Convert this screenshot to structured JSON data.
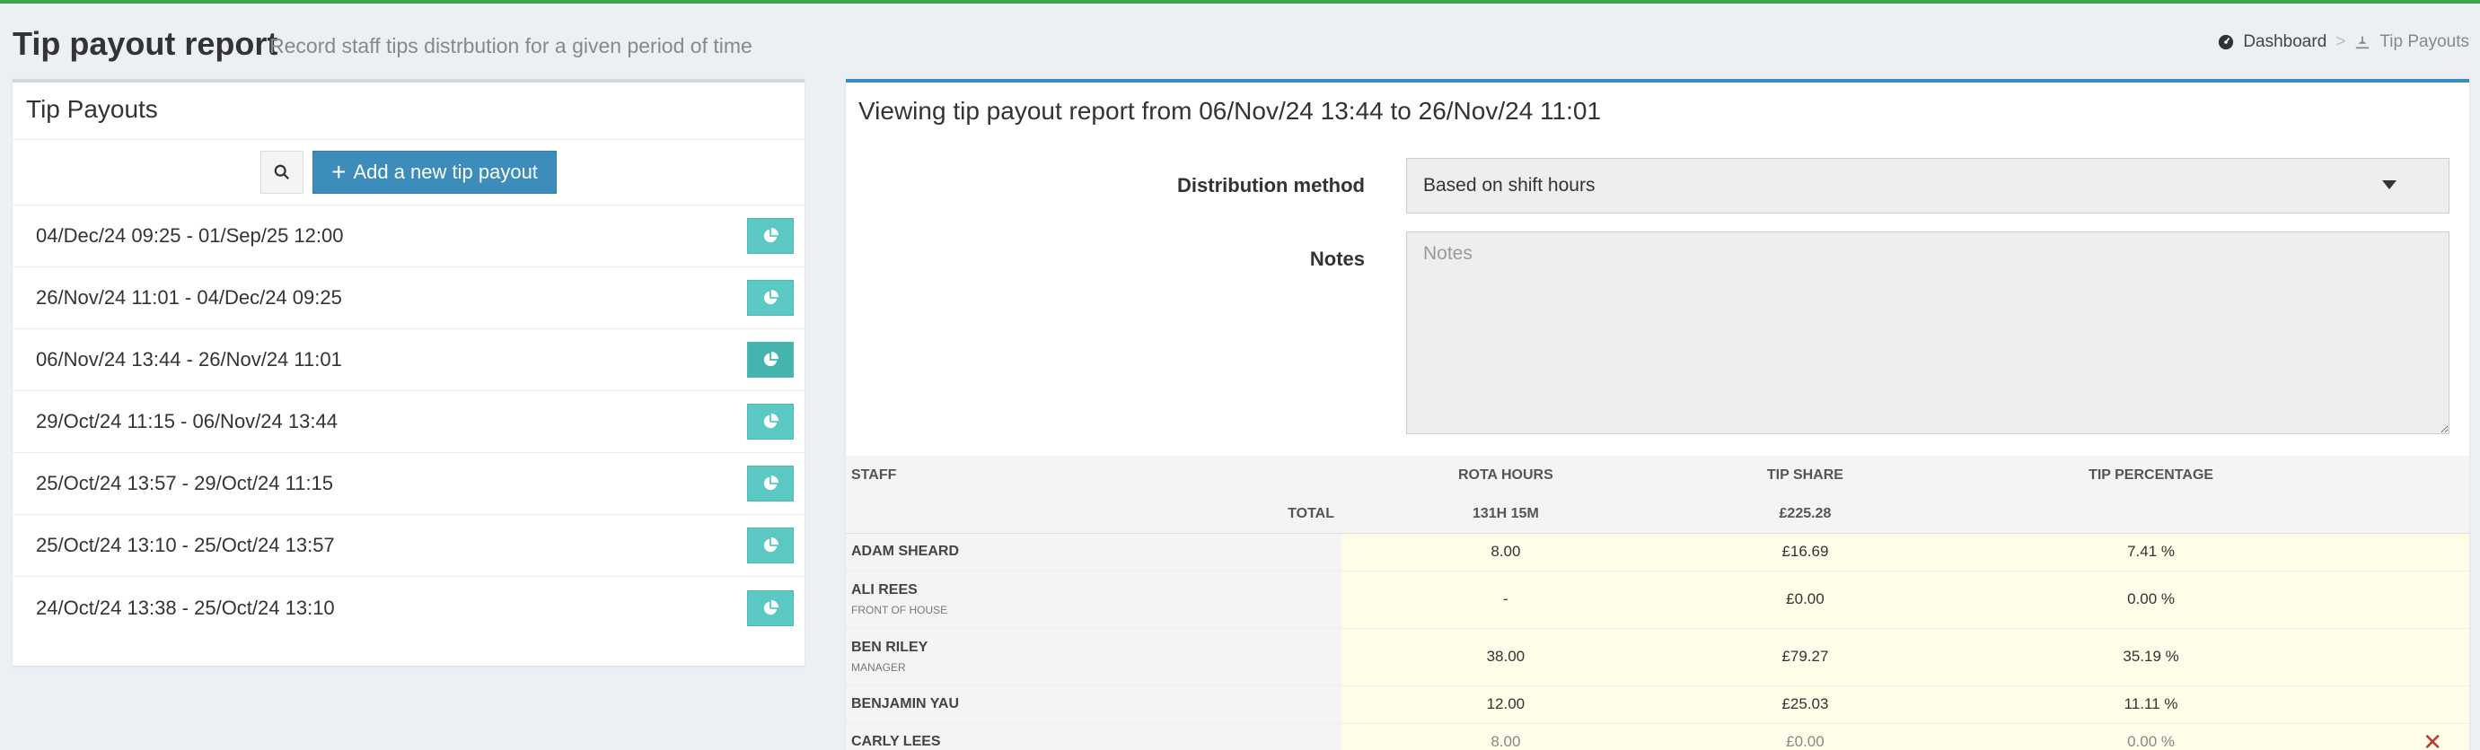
{
  "header": {
    "title": "Tip payout report",
    "subtitle": "Record staff tips distrbution for a given period of time"
  },
  "breadcrumb": {
    "dashboard": "Dashboard",
    "separator": ">",
    "current": "Tip Payouts"
  },
  "left_panel": {
    "title": "Tip Payouts",
    "add_button": "Add a new tip payout",
    "items": [
      {
        "label": "04/Dec/24 09:25 - 01/Sep/25 12:00",
        "active": false
      },
      {
        "label": "26/Nov/24 11:01 - 04/Dec/24 09:25",
        "active": false
      },
      {
        "label": "06/Nov/24 13:44 - 26/Nov/24 11:01",
        "active": true
      },
      {
        "label": "29/Oct/24 11:15 - 06/Nov/24 13:44",
        "active": false
      },
      {
        "label": "25/Oct/24 13:57 - 29/Oct/24 11:15",
        "active": false
      },
      {
        "label": "25/Oct/24 13:10 - 25/Oct/24 13:57",
        "active": false
      },
      {
        "label": "24/Oct/24 13:38 - 25/Oct/24 13:10",
        "active": false
      }
    ]
  },
  "report": {
    "title": "Viewing tip payout report from 06/Nov/24 13:44 to 26/Nov/24 11:01",
    "distribution_label": "Distribution method",
    "distribution_value": "Based on shift hours",
    "notes_label": "Notes",
    "notes_placeholder": "Notes",
    "notes_value": ""
  },
  "table": {
    "headers": {
      "staff": "Staff",
      "rota_hours": "Rota Hours",
      "tip_share": "Tip Share",
      "tip_percentage": "Tip Percentage"
    },
    "totals": {
      "label": "TOTAL",
      "rota_hours": "131H 15M",
      "tip_share": "£225.28"
    },
    "rows": [
      {
        "name": "ADAM SHEARD",
        "role": "",
        "hours": "8.00",
        "share": "£16.69",
        "pct": "7.41 %",
        "removed": false
      },
      {
        "name": "ALI REES",
        "role": "FRONT OF HOUSE",
        "hours": "-",
        "share": "£0.00",
        "pct": "0.00 %",
        "removed": false
      },
      {
        "name": "BEN RILEY",
        "role": "MANAGER",
        "hours": "38.00",
        "share": "£79.27",
        "pct": "35.19 %",
        "removed": false
      },
      {
        "name": "BENJAMIN YAU",
        "role": "",
        "hours": "12.00",
        "share": "£25.03",
        "pct": "11.11 %",
        "removed": false
      },
      {
        "name": "CARLY LEES",
        "role": "",
        "hours": "8.00",
        "share": "£0.00",
        "pct": "0.00 %",
        "removed": true
      }
    ],
    "remove_symbol": "✕"
  },
  "colors": {
    "accent": "#3c8dbc",
    "top_bar": "#3fa34d",
    "pie_button": "#5bc8c4",
    "row_highlight": "#fdfde8",
    "remove": "#c0392b"
  }
}
